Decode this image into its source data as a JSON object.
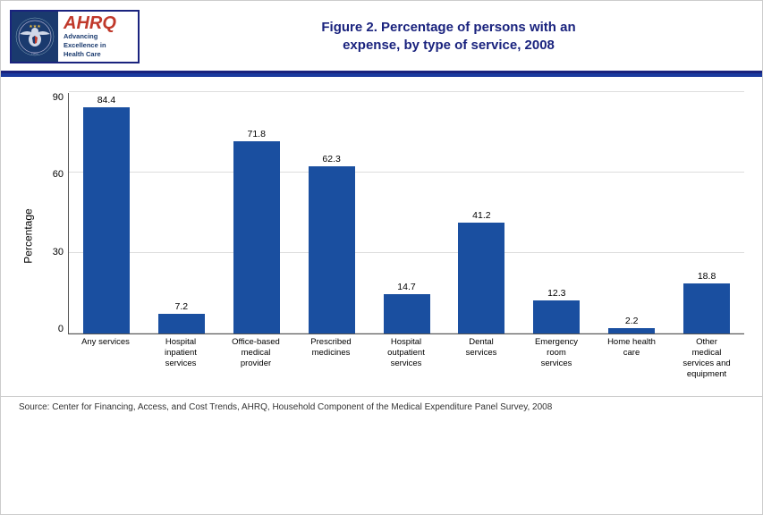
{
  "header": {
    "title_line1": "Figure 2. Percentage of persons with an",
    "title_line2": "expense, by type of service, 2008",
    "ahrq_label": "AHRQ",
    "ahrq_sub1": "Advancing",
    "ahrq_sub2": "Excellence in",
    "ahrq_sub3": "Health Care"
  },
  "chart": {
    "y_axis_label": "Percentage",
    "y_ticks": [
      "0",
      "30",
      "60",
      "90"
    ],
    "bars": [
      {
        "label": "Any services",
        "value": 84.4,
        "height_pct": 93.8
      },
      {
        "label": "Hospital\ninpatient\nservices",
        "value": 7.2,
        "height_pct": 8.0
      },
      {
        "label": "Office-based\nmedical\nprovider",
        "value": 71.8,
        "height_pct": 79.8
      },
      {
        "label": "Prescribed\nmedicines",
        "value": 62.3,
        "height_pct": 69.2
      },
      {
        "label": "Hospital\noutpatient\nservices",
        "value": 14.7,
        "height_pct": 16.3
      },
      {
        "label": "Dental\nservices",
        "value": 41.2,
        "height_pct": 45.8
      },
      {
        "label": "Emergency\nroom\nservices",
        "value": 12.3,
        "height_pct": 13.7
      },
      {
        "label": "Home health\ncare",
        "value": 2.2,
        "height_pct": 2.4
      },
      {
        "label": "Other\nmedical\nservices and\nequipment",
        "value": 18.8,
        "height_pct": 20.9
      }
    ],
    "bar_color": "#1a4fa0"
  },
  "footer": {
    "source": "Source: Center for Financing, Access, and Cost Trends, AHRQ, Household Component of the Medical Expenditure Panel Survey, 2008"
  }
}
